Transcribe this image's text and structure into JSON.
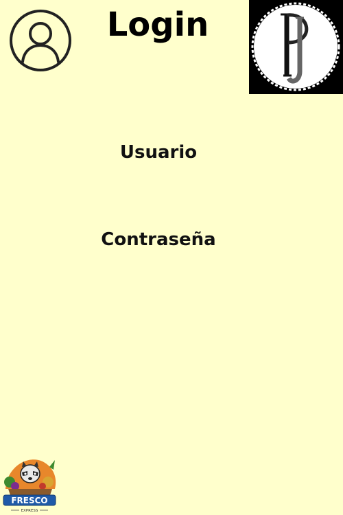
{
  "header": {
    "title": "Login",
    "user_icon": "user-circle-icon",
    "logo_icon": "pj-monogram-logo"
  },
  "form": {
    "username_label": "Usuario",
    "username_value": "",
    "password_label": "Contraseña",
    "password_value": ""
  },
  "footer": {
    "brand_name": "FRESCO",
    "brand_tagline": "EXPRESS"
  },
  "colors": {
    "background": "#ffffcc",
    "text": "#000000",
    "logo_background": "#000000"
  }
}
